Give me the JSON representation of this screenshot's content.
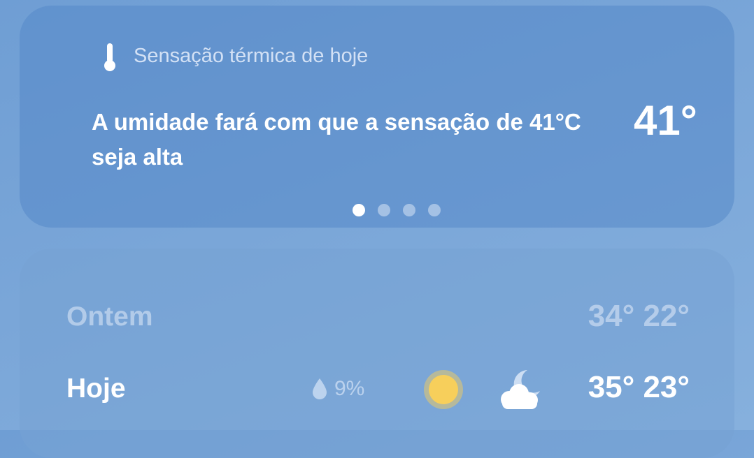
{
  "feels_like": {
    "icon": "thermometer-icon",
    "label": "Sensação térmica de hoje",
    "description": "A umidade fará com que a sensação de 41°C seja alta",
    "value": "41°",
    "pager": {
      "total": 4,
      "active_index": 0
    }
  },
  "forecast": {
    "yesterday": {
      "day": "Ontem",
      "temps": "34° 22°"
    },
    "today": {
      "day": "Hoje",
      "precip_icon": "raindrop-icon",
      "precip": "9%",
      "day_icon": "sun-icon",
      "night_icon": "moon-cloud-icon",
      "temps": "35° 23°"
    }
  },
  "colors": {
    "sun": "#f7cf5b",
    "sun_ring": "#e8c86a",
    "text_primary": "#ffffff"
  }
}
